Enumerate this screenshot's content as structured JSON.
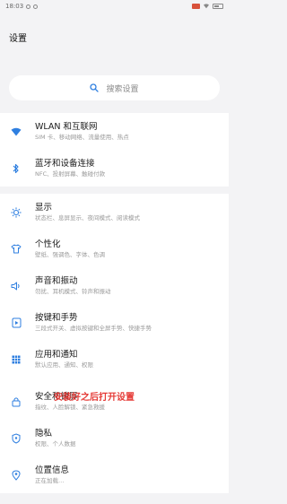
{
  "status_bar": {
    "time": "18:03"
  },
  "page_title": "设置",
  "search": {
    "placeholder": "搜索设置"
  },
  "groups": [
    {
      "items": [
        {
          "title": "WLAN 和互联网",
          "subtitle": "SIM 卡、移动网络、流量使用、热点",
          "icon": "wifi-icon"
        },
        {
          "title": "蓝牙和设备连接",
          "subtitle": "NFC、投射屏幕、触碰付款",
          "icon": "bluetooth-icon"
        }
      ]
    },
    {
      "items": [
        {
          "title": "显示",
          "subtitle": "状态栏、息屏显示、夜间模式、阅读模式",
          "icon": "brightness-icon"
        },
        {
          "title": "个性化",
          "subtitle": "壁纸、强调色、字体、色调",
          "icon": "shirt-icon"
        },
        {
          "title": "声音和振动",
          "subtitle": "勿扰、耳机模式、铃声和振动",
          "icon": "speaker-icon"
        },
        {
          "title": "按键和手势",
          "subtitle": "三段式开关、虚拟按键和全屏手势、快捷手势",
          "icon": "touch-icon"
        },
        {
          "title": "应用和通知",
          "subtitle": "默认应用、通知、权限",
          "icon": "apps-grid-icon"
        },
        {
          "title": "安全和锁屏",
          "subtitle": "指纹、人脸解锁、紧急救援",
          "icon": "lock-icon"
        },
        {
          "title": "隐私",
          "subtitle": "权限、个人数据",
          "icon": "shield-icon"
        },
        {
          "title": "位置信息",
          "subtitle": "正在加载…",
          "icon": "location-icon"
        }
      ]
    }
  ],
  "overlay_hint": "安装好之后打开设置",
  "colors": {
    "accent": "#2f7fe0",
    "hint": "#e53935"
  }
}
